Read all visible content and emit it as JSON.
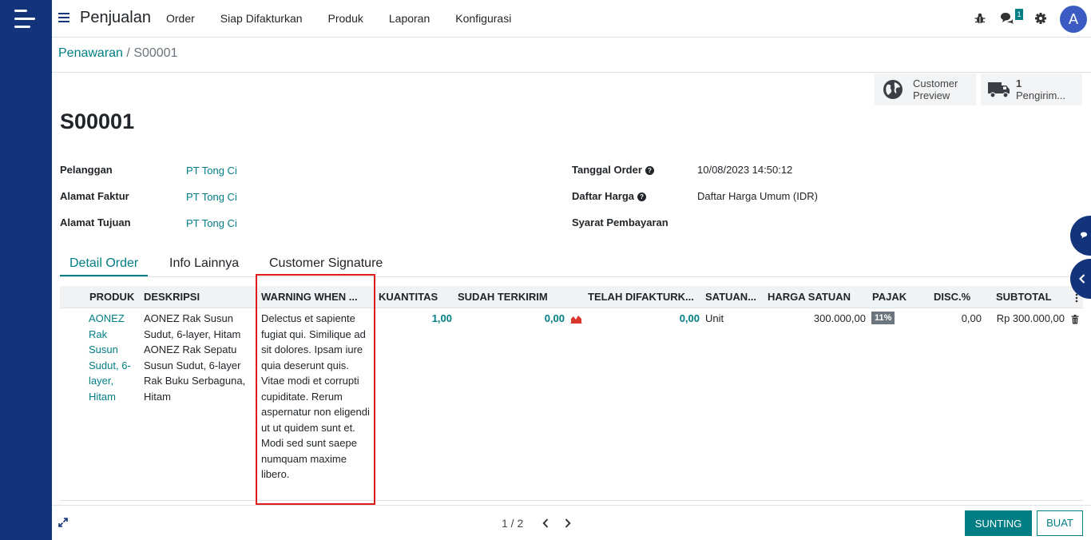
{
  "app": {
    "title": "Penjualan"
  },
  "menus": [
    {
      "label": "Order"
    },
    {
      "label": "Siap Difakturkan"
    },
    {
      "label": "Produk"
    },
    {
      "label": "Laporan"
    },
    {
      "label": "Konfigurasi"
    }
  ],
  "systray": {
    "messages_count": "1",
    "avatar_letter": "A"
  },
  "breadcrumb": {
    "parent": "Penawaran",
    "separator": "/",
    "current": "S00001"
  },
  "smart_buttons": {
    "customer_preview": {
      "line1": "Customer",
      "line2": "Preview"
    },
    "delivery": {
      "count": "1",
      "label": "Pengirim..."
    }
  },
  "record": {
    "name": "S00001"
  },
  "fields": {
    "customer": {
      "label": "Pelanggan",
      "value": "PT Tong Ci"
    },
    "invoice_address": {
      "label": "Alamat Faktur",
      "value": "PT Tong Ci"
    },
    "delivery_address": {
      "label": "Alamat Tujuan",
      "value": "PT Tong Ci"
    },
    "order_date": {
      "label": "Tanggal Order",
      "help": "?",
      "value": "10/08/2023 14:50:12"
    },
    "pricelist": {
      "label": "Daftar Harga",
      "help": "?",
      "value": "Daftar Harga Umum (IDR)"
    },
    "payment_terms": {
      "label": "Syarat Pembayaran",
      "value": ""
    }
  },
  "tabs": [
    {
      "label": "Detail Order",
      "active": true
    },
    {
      "label": "Info Lainnya",
      "active": false
    },
    {
      "label": "Customer Signature",
      "active": false
    }
  ],
  "order_lines": {
    "headers": {
      "product": "PRODUK",
      "description": "DESKRIPSI",
      "warning": "WARNING WHEN ...",
      "quantity": "KUANTITAS",
      "delivered": "SUDAH TERKIRIM",
      "invoiced": "TELAH DIFAKTURK...",
      "uom": "SATUAN...",
      "unit_price": "HARGA SATUAN",
      "tax": "PAJAK",
      "discount": "DISC.%",
      "subtotal": "SUBTOTAL"
    },
    "rows": [
      {
        "product": "AONEZ Rak Susun Sudut, 6-layer, Hitam",
        "description": "AONEZ Rak Susun Sudut, 6-layer, Hitam AONEZ Rak Sepatu Susun Sudut, 6-layer Rak Buku Serbaguna, Hitam",
        "warning": "Delectus et sapiente fugiat qui. Similique ad sit dolores. Ipsam iure quia deserunt quis. Vitae modi et corrupti cupiditate. Rerum aspernatur non eligendi ut ut quidem sunt et. Modi sed sunt saepe numquam maxime libero.",
        "quantity": "1,00",
        "delivered": "0,00",
        "invoiced": "0,00",
        "uom": "Unit",
        "unit_price": "300.000,00",
        "tax": "11%",
        "discount": "0,00",
        "subtotal": "Rp 300.000,00"
      }
    ]
  },
  "pager": {
    "value": "1 / 2"
  },
  "footer_buttons": {
    "edit": "SUNTING",
    "create": "BUAT"
  },
  "colors": {
    "brand": "#13347a",
    "accent": "#017e84",
    "highlight": "#e01b1b"
  }
}
